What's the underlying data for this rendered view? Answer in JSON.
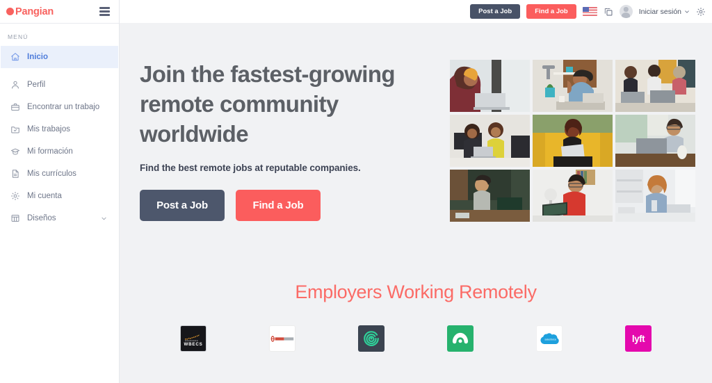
{
  "sidebar": {
    "brand": {
      "name": "Pangian",
      "dot_color": "#f8625f"
    },
    "menu_label": "MENÚ",
    "items": [
      {
        "label": "Inicio",
        "icon": "home-icon",
        "active": true
      },
      {
        "label": "Perfil",
        "icon": "user-icon",
        "active": false
      },
      {
        "label": "Encontrar un trabajo",
        "icon": "briefcase-icon",
        "active": false
      },
      {
        "label": "Mis trabajos",
        "icon": "folder-check-icon",
        "active": false
      },
      {
        "label": "Mi formación",
        "icon": "graduation-cap-icon",
        "active": false
      },
      {
        "label": "Mis currículos",
        "icon": "document-icon",
        "active": false
      },
      {
        "label": "Mi cuenta",
        "icon": "gear-icon",
        "active": false
      },
      {
        "label": "Diseños",
        "icon": "grid-icon",
        "active": false,
        "has_chevron": true
      }
    ]
  },
  "topbar": {
    "post_job_label": "Post a Job",
    "find_job_label": "Find a Job",
    "language_flag": "us-flag-icon",
    "duplicate_icon": "duplicate-icon",
    "signin_label": "Iniciar sesión",
    "settings_icon": "gear-icon",
    "post_job_color": "#485267",
    "find_job_color": "#fb5d5d"
  },
  "hero": {
    "title": "Join the fastest-growing remote community worldwide",
    "subtitle": "Find the best remote jobs at reputable companies.",
    "primary_button": "Post a Job",
    "secondary_button": "Find a Job",
    "primary_color": "#4d576c",
    "secondary_color": "#fb5d5d",
    "photos": [
      {
        "alt": "woman with headphones at laptop by window"
      },
      {
        "alt": "man waving at desk video call"
      },
      {
        "alt": "three women working on laptops on couch"
      },
      {
        "alt": "two women sharing a laptop at table"
      },
      {
        "alt": "woman on yellow couch with laptop"
      },
      {
        "alt": "man with glasses at laptop with coffee"
      },
      {
        "alt": "woman at cafe table with laptop"
      },
      {
        "alt": "man in red shirt typing on laptop"
      },
      {
        "alt": "woman with curly hair typing at desk"
      }
    ]
  },
  "employers": {
    "heading": "Employers Working Remotely",
    "heading_color": "#fb6b66",
    "logos": [
      {
        "name": "WBECS",
        "text": "WBECS",
        "bg": "#16161a"
      },
      {
        "name": "EmberTribe",
        "text": "EMBERTRIBE",
        "bg": "#ffffff"
      },
      {
        "name": "Toptal-style teal mark",
        "text": "",
        "bg": "#3b4450"
      },
      {
        "name": "Hopper",
        "text": "",
        "bg": "#26b26d"
      },
      {
        "name": "Salesforce",
        "text": "salesforce",
        "bg": "#ffffff"
      },
      {
        "name": "Lyft",
        "text": "lyft",
        "bg": "#e409ad"
      }
    ]
  }
}
